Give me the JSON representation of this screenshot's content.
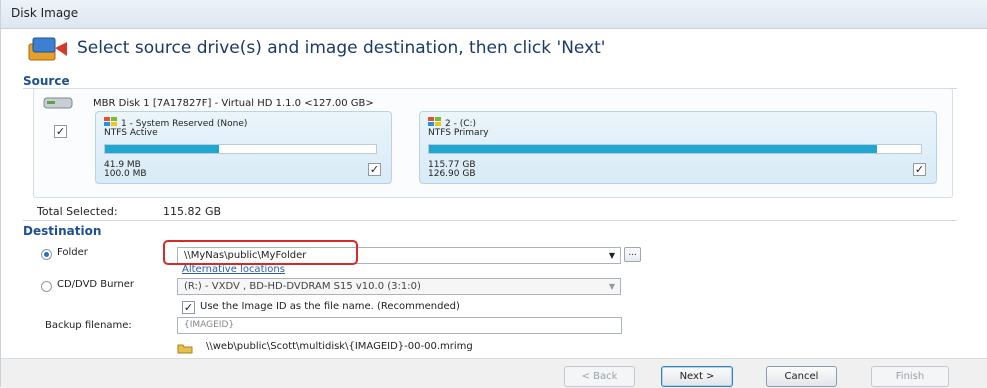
{
  "window": {
    "title": "Disk Image"
  },
  "header": {
    "text": "Select source drive(s) and image destination, then click 'Next'"
  },
  "source": {
    "label": "Source",
    "disk": {
      "label": "MBR Disk 1 [7A17827F] - Virtual HD 1.1.0  <127.00 GB>",
      "checked": true
    },
    "partitions": [
      {
        "title": "1 - System Reserved (None)",
        "fs": "NTFS Active",
        "used": "41.9 MB",
        "total": "100.0 MB",
        "fill_fraction": 0.42,
        "checked": true
      },
      {
        "title": "2 - (C:)",
        "fs": "NTFS Primary",
        "used": "115.77 GB",
        "total": "126.90 GB",
        "fill_fraction": 0.91,
        "checked": true
      }
    ],
    "total_selected_label": "Total Selected:",
    "total_selected_value": "115.82 GB"
  },
  "destination": {
    "label": "Destination",
    "folder_label": "Folder",
    "folder_value": "\\\\MyNas\\public\\MyFolder",
    "alternative_link": "Alternative locations",
    "cd_label": "CD/DVD Burner",
    "cd_value": "(R:) - VXDV    , BD-HD-DVDRAM S15 v10.0 (3:1:0)",
    "use_id_label": "Use the Image ID as the file name.  (Recommended)",
    "backup_label": "Backup filename:",
    "backup_placeholder": "{IMAGEID}",
    "path_preview": "\\\\web\\public\\Scott\\multidisk\\{IMAGEID}-00-00.mrimg"
  },
  "buttons": {
    "back": "< Back",
    "next": "Next >",
    "cancel": "Cancel",
    "finish": "Finish"
  },
  "ellipsis": "...",
  "icons": {
    "header": "disk-image-icon",
    "disk": "hard-disk-icon",
    "partition": "windows-flag-icon",
    "path": "folder-key-icon"
  },
  "colors": {
    "accent": "#1f4f8f",
    "bar_fill": "#1fa7cf",
    "highlight": "#d42a2a"
  }
}
